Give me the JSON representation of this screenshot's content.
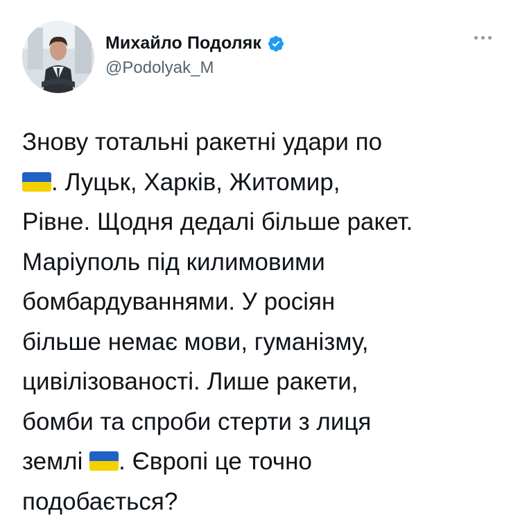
{
  "author": {
    "display_name": "Михайло Подоляк",
    "handle": "@Podolyak_M",
    "verified": true,
    "avatar_icon": "profile-photo"
  },
  "more_icon": "more-options-icon",
  "tweet": {
    "line1": "Знову тотальні ракетні удари по",
    "line2_after_flag": ". Луцьк, Харків, Житомир,",
    "line3": "Рівне. Щодня дедалі більше ракет.",
    "line4": "Маріуполь під килимовими",
    "line5": "бомбардуваннями. У росіян",
    "line6": "більше немає мови, гуманізму,",
    "line7": "цивілізованості. Лише ракети,",
    "line8": "бомби та спроби стерти з лиця",
    "line9_before_flag": "землі",
    "line9_after_flag": ". Європі це точно",
    "line10": "подобається?"
  },
  "colors": {
    "text": "#0f1419",
    "secondary": "#536471",
    "verified_blue": "#1d9bf0",
    "flag_blue": "#1f61c7",
    "flag_yellow": "#f5d100"
  }
}
